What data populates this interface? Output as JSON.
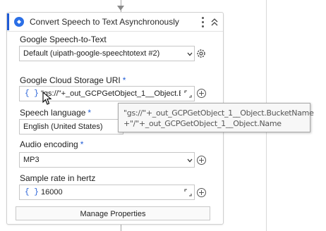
{
  "activity": {
    "title": "Convert Speech to Text Asynchronously",
    "accent_color": "#1f5bd6",
    "icon": "speech-to-text-icon"
  },
  "fields": {
    "connection": {
      "label": "Google Speech-to-Text",
      "value": "Default (uipath-google-speechtotext #2)"
    },
    "storage_uri": {
      "label": "Google Cloud Storage URI",
      "required_mark": "*",
      "value": "\"gs://\"+_out_GCPGetObject_1__Object.Bu"
    },
    "speech_language": {
      "label": "Speech language",
      "required_mark": "*",
      "value": "English (United States)"
    },
    "audio_encoding": {
      "label": "Audio encoding",
      "required_mark": "*",
      "value": "MP3"
    },
    "sample_rate": {
      "label": "Sample rate in hertz",
      "value": "16000"
    }
  },
  "expression_glyph": "{ }",
  "manage_properties_label": "Manage Properties",
  "tooltip": {
    "line1": "\"gs://\"+_out_GCPGetObject_1__Object.BucketName",
    "line2": "+\"/\"+_out_GCPGetObject_1__Object.Name"
  }
}
